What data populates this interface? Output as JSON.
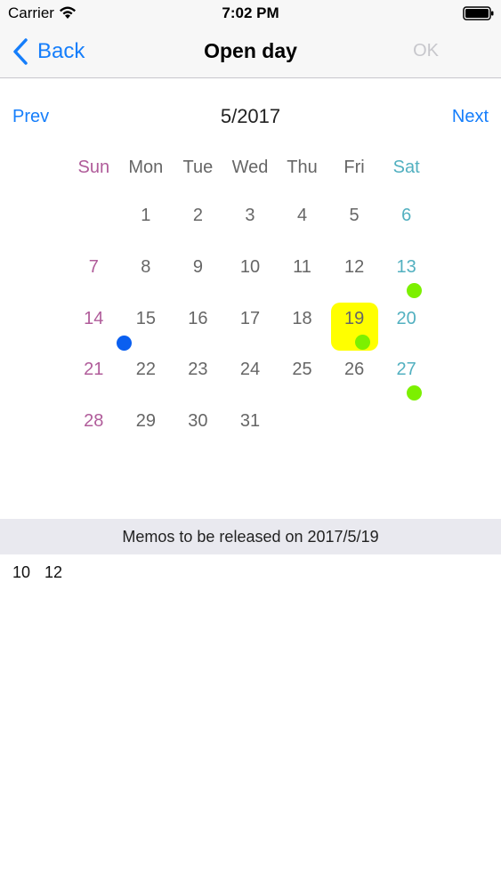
{
  "status_bar": {
    "carrier": "Carrier",
    "time": "7:02 PM"
  },
  "nav": {
    "back_label": "Back",
    "title": "Open day",
    "ok_label": "OK"
  },
  "calendar": {
    "prev_label": "Prev",
    "next_label": "Next",
    "month_label": "5/2017",
    "weekdays": [
      "Sun",
      "Mon",
      "Tue",
      "Wed",
      "Thu",
      "Fri",
      "Sat"
    ],
    "first_weekday_index": 1,
    "days_in_month": 31,
    "selected_day": 19,
    "markers": [
      {
        "day": 13,
        "color": "green"
      },
      {
        "day": 15,
        "color": "blue"
      },
      {
        "day": 19,
        "color": "green"
      },
      {
        "day": 27,
        "color": "green"
      }
    ],
    "colors": {
      "sunday": "#b05c9a",
      "saturday": "#52b0c0",
      "selected": "#ffff00",
      "marker_green": "#7cf000",
      "marker_blue": "#0a5ff0"
    }
  },
  "memos": {
    "header": "Memos to be released on 2017/5/19",
    "items": [
      "10",
      "12"
    ]
  }
}
